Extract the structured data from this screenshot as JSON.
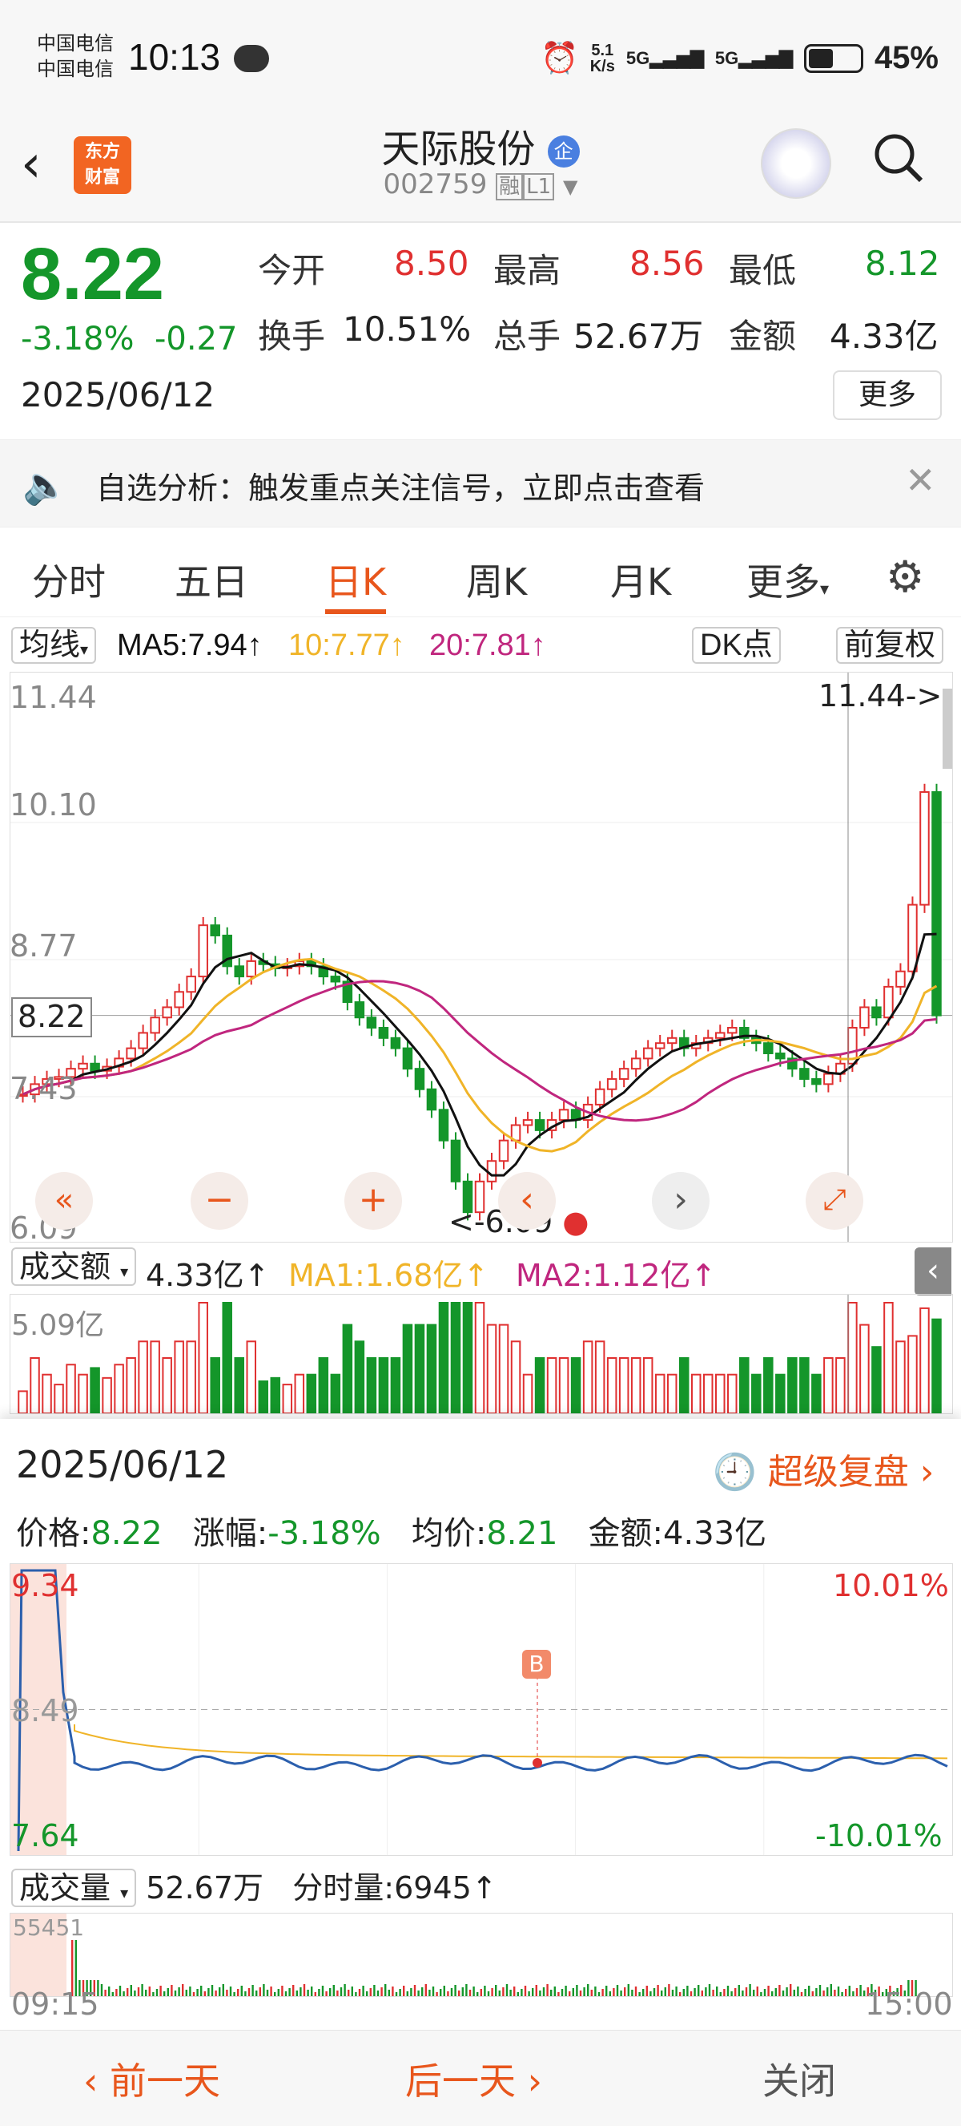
{
  "status": {
    "carrier1": "中国电信",
    "carrier2": "中国电信",
    "time": "10:13",
    "net_speed_top": "5.1",
    "net_speed_bottom": "K/s",
    "sig1": "5G",
    "sig2": "5G",
    "battery": "45%"
  },
  "header": {
    "title": "天际股份",
    "badge": "企",
    "code": "002759",
    "tag1": "融",
    "tag2": "L1"
  },
  "quote": {
    "price": "8.22",
    "change_pct": "-3.18%",
    "change_val": "-0.27",
    "date": "2025/06/12",
    "open_label": "今开",
    "open": "8.50",
    "high_label": "最高",
    "high": "8.56",
    "low_label": "最低",
    "low": "8.12",
    "turnover_label": "换手",
    "turnover": "10.51%",
    "volume_label": "总手",
    "volume": "52.67万",
    "amount_label": "金额",
    "amount": "4.33亿",
    "more": "更多"
  },
  "notice": {
    "text": "自选分析：触发重点关注信号，立即点击查看"
  },
  "tabs": [
    "分时",
    "五日",
    "日K",
    "周K",
    "月K",
    "更多"
  ],
  "ma": {
    "selector": "均线",
    "ma5": "MA5:7.94↑",
    "ma10": "10:7.77↑",
    "ma20": "20:7.81↑",
    "dk": "DK点",
    "fq": "前复权"
  },
  "chart_data": {
    "type": "candlestick",
    "y_ticks": [
      "11.44",
      "10.10",
      "8.77",
      "7.43",
      "6.09"
    ],
    "current": "8.22",
    "max_label": "11.44->",
    "min_label": "<-6.09",
    "ylim": [
      6.09,
      11.44
    ],
    "close": [
      7.45,
      7.55,
      7.6,
      7.62,
      7.7,
      7.75,
      7.68,
      7.72,
      7.8,
      7.9,
      8.05,
      8.2,
      8.3,
      8.45,
      8.6,
      9.1,
      9.0,
      8.7,
      8.6,
      8.75,
      8.72,
      8.68,
      8.7,
      8.75,
      8.7,
      8.6,
      8.55,
      8.35,
      8.2,
      8.1,
      8.0,
      7.9,
      7.7,
      7.5,
      7.3,
      7.0,
      6.6,
      6.3,
      6.6,
      6.8,
      7.0,
      7.15,
      7.2,
      7.1,
      7.2,
      7.3,
      7.2,
      7.35,
      7.5,
      7.6,
      7.7,
      7.8,
      7.9,
      7.95,
      8.0,
      7.9,
      7.95,
      8.0,
      8.05,
      8.1,
      8.0,
      7.95,
      7.85,
      7.8,
      7.7,
      7.6,
      7.55,
      7.65,
      7.75,
      8.1,
      8.3,
      8.2,
      8.5,
      8.65,
      9.3,
      10.4,
      8.22
    ],
    "ma5_end": "7.94",
    "ma10_end": "7.77",
    "ma20_end": "7.81"
  },
  "volume": {
    "selector": "成交额",
    "value": "4.33亿↑",
    "ma1": "MA1:1.68亿↑",
    "ma2": "MA2:1.12亿↑",
    "tick": "5.09亿"
  },
  "panel": {
    "date": "2025/06/12",
    "review": "超级复盘",
    "price_label": "价格:",
    "price": "8.22",
    "pct_label": "涨幅:",
    "pct": "-3.18%",
    "avg_label": "均价:",
    "avg": "8.21",
    "amt_label": "金额:",
    "amt": "4.33亿",
    "top": "9.34",
    "mid": "8.49",
    "bottom": "7.64",
    "top_pct": "10.01%",
    "bottom_pct": "-10.01%",
    "marker": "B",
    "vol_selector": "成交量",
    "vol_total": "52.67万",
    "vol_tick_label": "分时量:6945↑",
    "vol_max": "55451",
    "t_start": "09:15",
    "t_end": "15:00"
  },
  "bottom": {
    "prev": "前一天",
    "next": "后一天",
    "close": "关闭"
  },
  "colors": {
    "up": "#e03030",
    "down": "#14962a",
    "accent": "#e8561c",
    "ma5": "#111111",
    "ma10": "#f0b428",
    "ma20": "#c0267e"
  }
}
